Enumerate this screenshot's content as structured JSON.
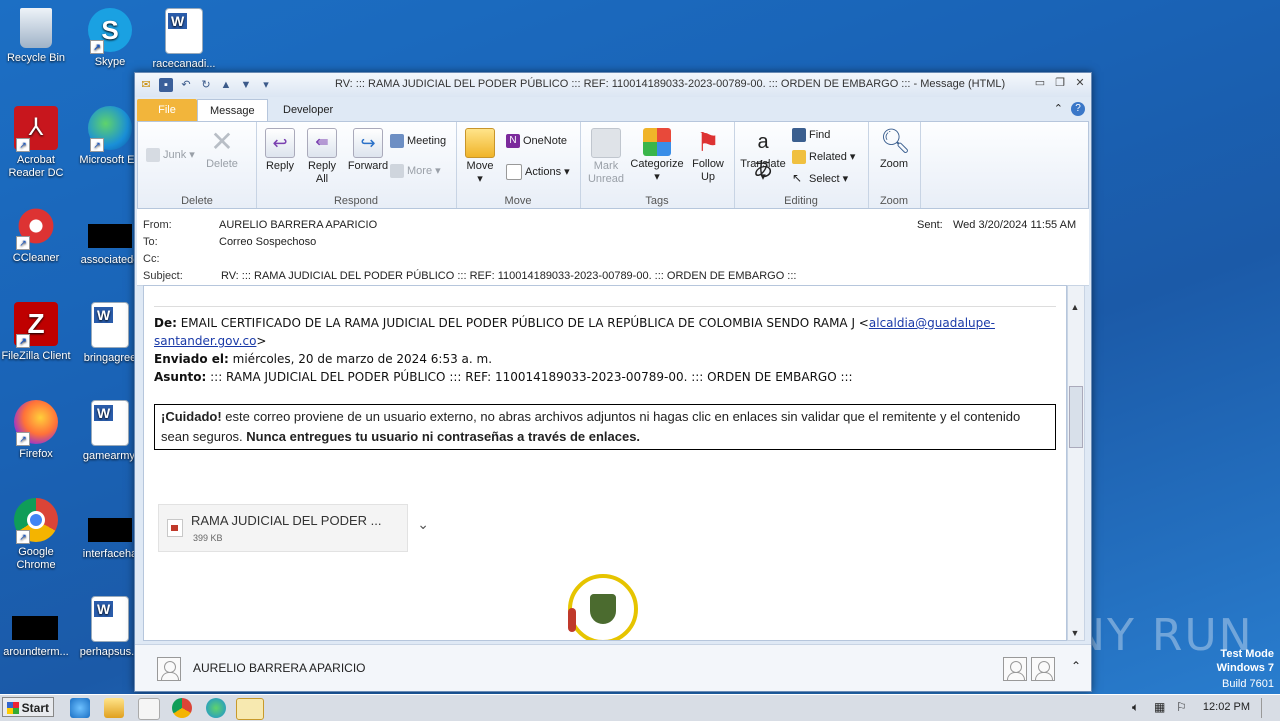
{
  "desktop": {
    "icons": [
      {
        "label": "Recycle Bin"
      },
      {
        "label": "Skype"
      },
      {
        "label": "racecanadi..."
      },
      {
        "label": "Acrobat Reader DC"
      },
      {
        "label": "Microsoft Ed"
      },
      {
        "label": "CCleaner"
      },
      {
        "label": "associatede"
      },
      {
        "label": "FileZilla Client"
      },
      {
        "label": "bringagree"
      },
      {
        "label": "Firefox"
      },
      {
        "label": "gamearmy."
      },
      {
        "label": "Google Chrome"
      },
      {
        "label": "interfaceha"
      },
      {
        "label": "aroundterm..."
      },
      {
        "label": "perhapsus..."
      }
    ]
  },
  "window": {
    "title": "RV: ::: RAMA JUDICIAL DEL PODER PÚBLICO ::: REF: 110014189033-2023-00789-00. ::: ORDEN DE EMBARGO ::: -  Message (HTML)",
    "tabs": {
      "file": "File",
      "message": "Message",
      "developer": "Developer"
    }
  },
  "ribbon": {
    "delete_group": {
      "junk": "Junk",
      "delete": "Delete",
      "label": "Delete"
    },
    "respond_group": {
      "reply": "Reply",
      "reply_all": "Reply All",
      "forward": "Forward",
      "meeting": "Meeting",
      "more": "More",
      "label": "Respond"
    },
    "move_group": {
      "move": "Move",
      "onenote": "OneNote",
      "actions": "Actions",
      "label": "Move"
    },
    "tags_group": {
      "mark_unread": "Mark Unread",
      "categorize": "Categorize",
      "follow_up": "Follow Up",
      "label": "Tags"
    },
    "editing_group": {
      "translate": "Translate",
      "find": "Find",
      "related": "Related",
      "select": "Select",
      "label": "Editing"
    },
    "zoom_group": {
      "zoom": "Zoom",
      "label": "Zoom"
    }
  },
  "header": {
    "from_label": "From:",
    "from": "AURELIO  BARRERA APARICIO",
    "to_label": "To:",
    "to": "Correo Sospechoso",
    "cc_label": "Cc:",
    "subject_label": "Subject:",
    "subject": "RV: ::: RAMA JUDICIAL DEL PODER PÚBLICO ::: REF: 110014189033-2023-00789-00. ::: ORDEN DE EMBARGO :::",
    "sent_label": "Sent:",
    "sent": "Wed 3/20/2024 11:55 AM"
  },
  "message": {
    "de_label": "De:",
    "de_text": " EMAIL CERTIFICADO DE LA RAMA JUDICIAL DEL PODER PÚBLICO DE LA REPÚBLICA DE COLOMBIA SENDO RAMA J <",
    "email": "alcaldia@guadalupe-santander.gov.co",
    "de_end": ">",
    "enviado_label": "Enviado el:",
    "enviado": " miércoles, 20 de marzo de 2024 6:53 a. m.",
    "asunto_label": "Asunto:",
    "asunto": " ::: RAMA JUDICIAL DEL PODER PÚBLICO ::: REF: 110014189033-2023-00789-00. ::: ORDEN DE EMBARGO :::",
    "warning_strong": "¡Cuidado!",
    "warning_text": " este correo proviene de un usuario externo, no abras archivos adjuntos ni hagas clic en enlaces sin validar que el remitente y el contenido sean seguros. ",
    "warning_strong2": "Nunca entregues tu usuario ni contraseñas a través de enlaces.",
    "attachment": {
      "name": "RAMA JUDICIAL DEL PODER ...",
      "size": "399 KB"
    }
  },
  "people_pane": {
    "name": "AURELIO  BARRERA APARICIO"
  },
  "taskbar": {
    "start": "Start",
    "clock": "12:02 PM"
  },
  "watermark": {
    "line1": "Test Mode",
    "line2": "Windows 7",
    "line3": "Build 7601",
    "brand": "ANY RUN"
  }
}
